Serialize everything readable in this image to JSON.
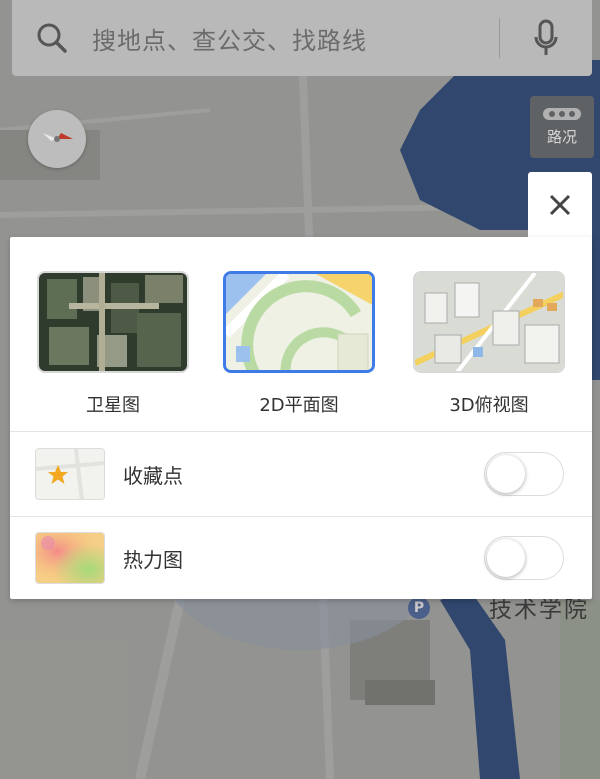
{
  "search": {
    "placeholder": "搜地点、查公交、找路线",
    "icon": "search-icon",
    "voice_icon": "microphone-icon"
  },
  "traffic_button": {
    "label": "路况",
    "icon": "traffic-icon"
  },
  "compass": {
    "icon": "compass-icon"
  },
  "map": {
    "poi_label": "技术学院",
    "parking_label": "P"
  },
  "layer_panel": {
    "close_icon": "close-icon",
    "modes": [
      {
        "label": "卫星图",
        "selected": false
      },
      {
        "label": "2D平面图",
        "selected": true
      },
      {
        "label": "3D俯视图",
        "selected": false
      }
    ],
    "overlays": [
      {
        "label": "收藏点",
        "enabled": false
      },
      {
        "label": "热力图",
        "enabled": false
      }
    ]
  },
  "colors": {
    "accent": "#3f7be6",
    "panel_bg": "#ffffff",
    "river": "#4a6aa3"
  }
}
